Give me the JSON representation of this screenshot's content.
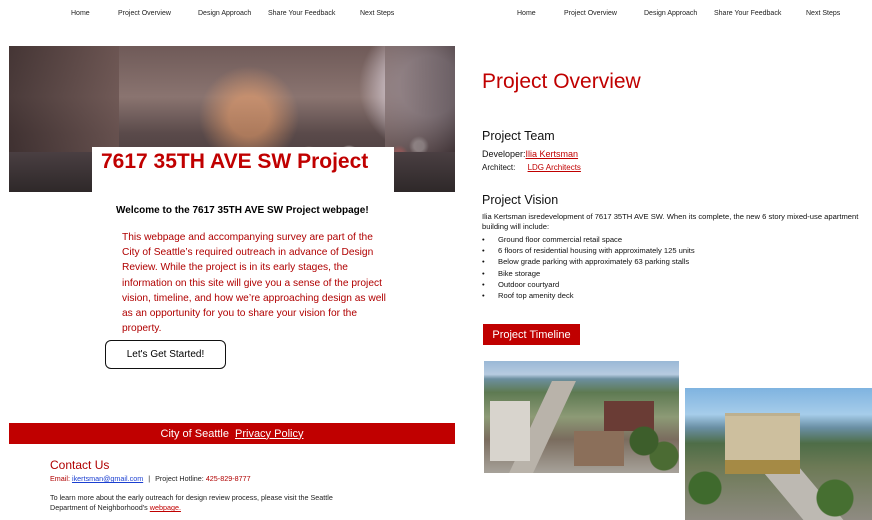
{
  "nav_left": [
    "Home",
    "Project Overview",
    "Design Approach",
    "Share Your Feedback",
    "Next Steps"
  ],
  "nav_right": [
    "Home",
    "Project Overview",
    "Design Approach",
    "Share Your Feedback",
    "Next Steps"
  ],
  "hero": {
    "title": "7617 35TH AVE SW Project",
    "image_icon": "street-photo-icon"
  },
  "welcome": "Welcome to the 7617 35TH AVE SW Project webpage!",
  "intro": "This webpage and accompanying survey are part of the City of Seattle’s required outreach in advance of Design Review. While the project is in its early stages, the information on this site will give you a sense of the project vision, timeline, and how we’re approaching design as well as an opportunity for you to share your vision for the property.",
  "cta_label": "Let's Get Started!",
  "footer": {
    "city": "City of Seattle",
    "privacy": "Privacy Policy"
  },
  "contact": {
    "title": "Contact Us",
    "email_label": "Email:",
    "email": "ikertsman@gmail.com",
    "separator": "|",
    "hotline_label": "Project Hotline:",
    "hotline": "425-829-8777",
    "learn_text": "To learn more about the early outreach for design review process, please visit the Seattle Department of Neighborhood’s",
    "learn_link": "webpage."
  },
  "overview": {
    "title": "Project Overview",
    "team_heading": "Project Team",
    "developer_label": "Developer:",
    "developer": "Ilia Kertsman",
    "architect_label": "Architect:",
    "architect": "LDG Architects",
    "vision_heading": "Project Vision",
    "vision_desc": "Ilia Kertsman isredevelopment of 7617 35TH AVE SW. When its complete, the new 6 story mixed-use apartment building will include:",
    "bullets": [
      "Ground floor commercial retail space",
      "6 floors of residential housing with approximately 125 units",
      "Below grade parking with approximately 63 parking stalls",
      "Bike storage",
      "Outdoor courtyard",
      "Roof top amenity deck"
    ],
    "bullet_char": "•",
    "timeline_label": "Project Timeline"
  },
  "colors": {
    "accent": "#c00000",
    "link_blue": "#1a3fd1"
  }
}
